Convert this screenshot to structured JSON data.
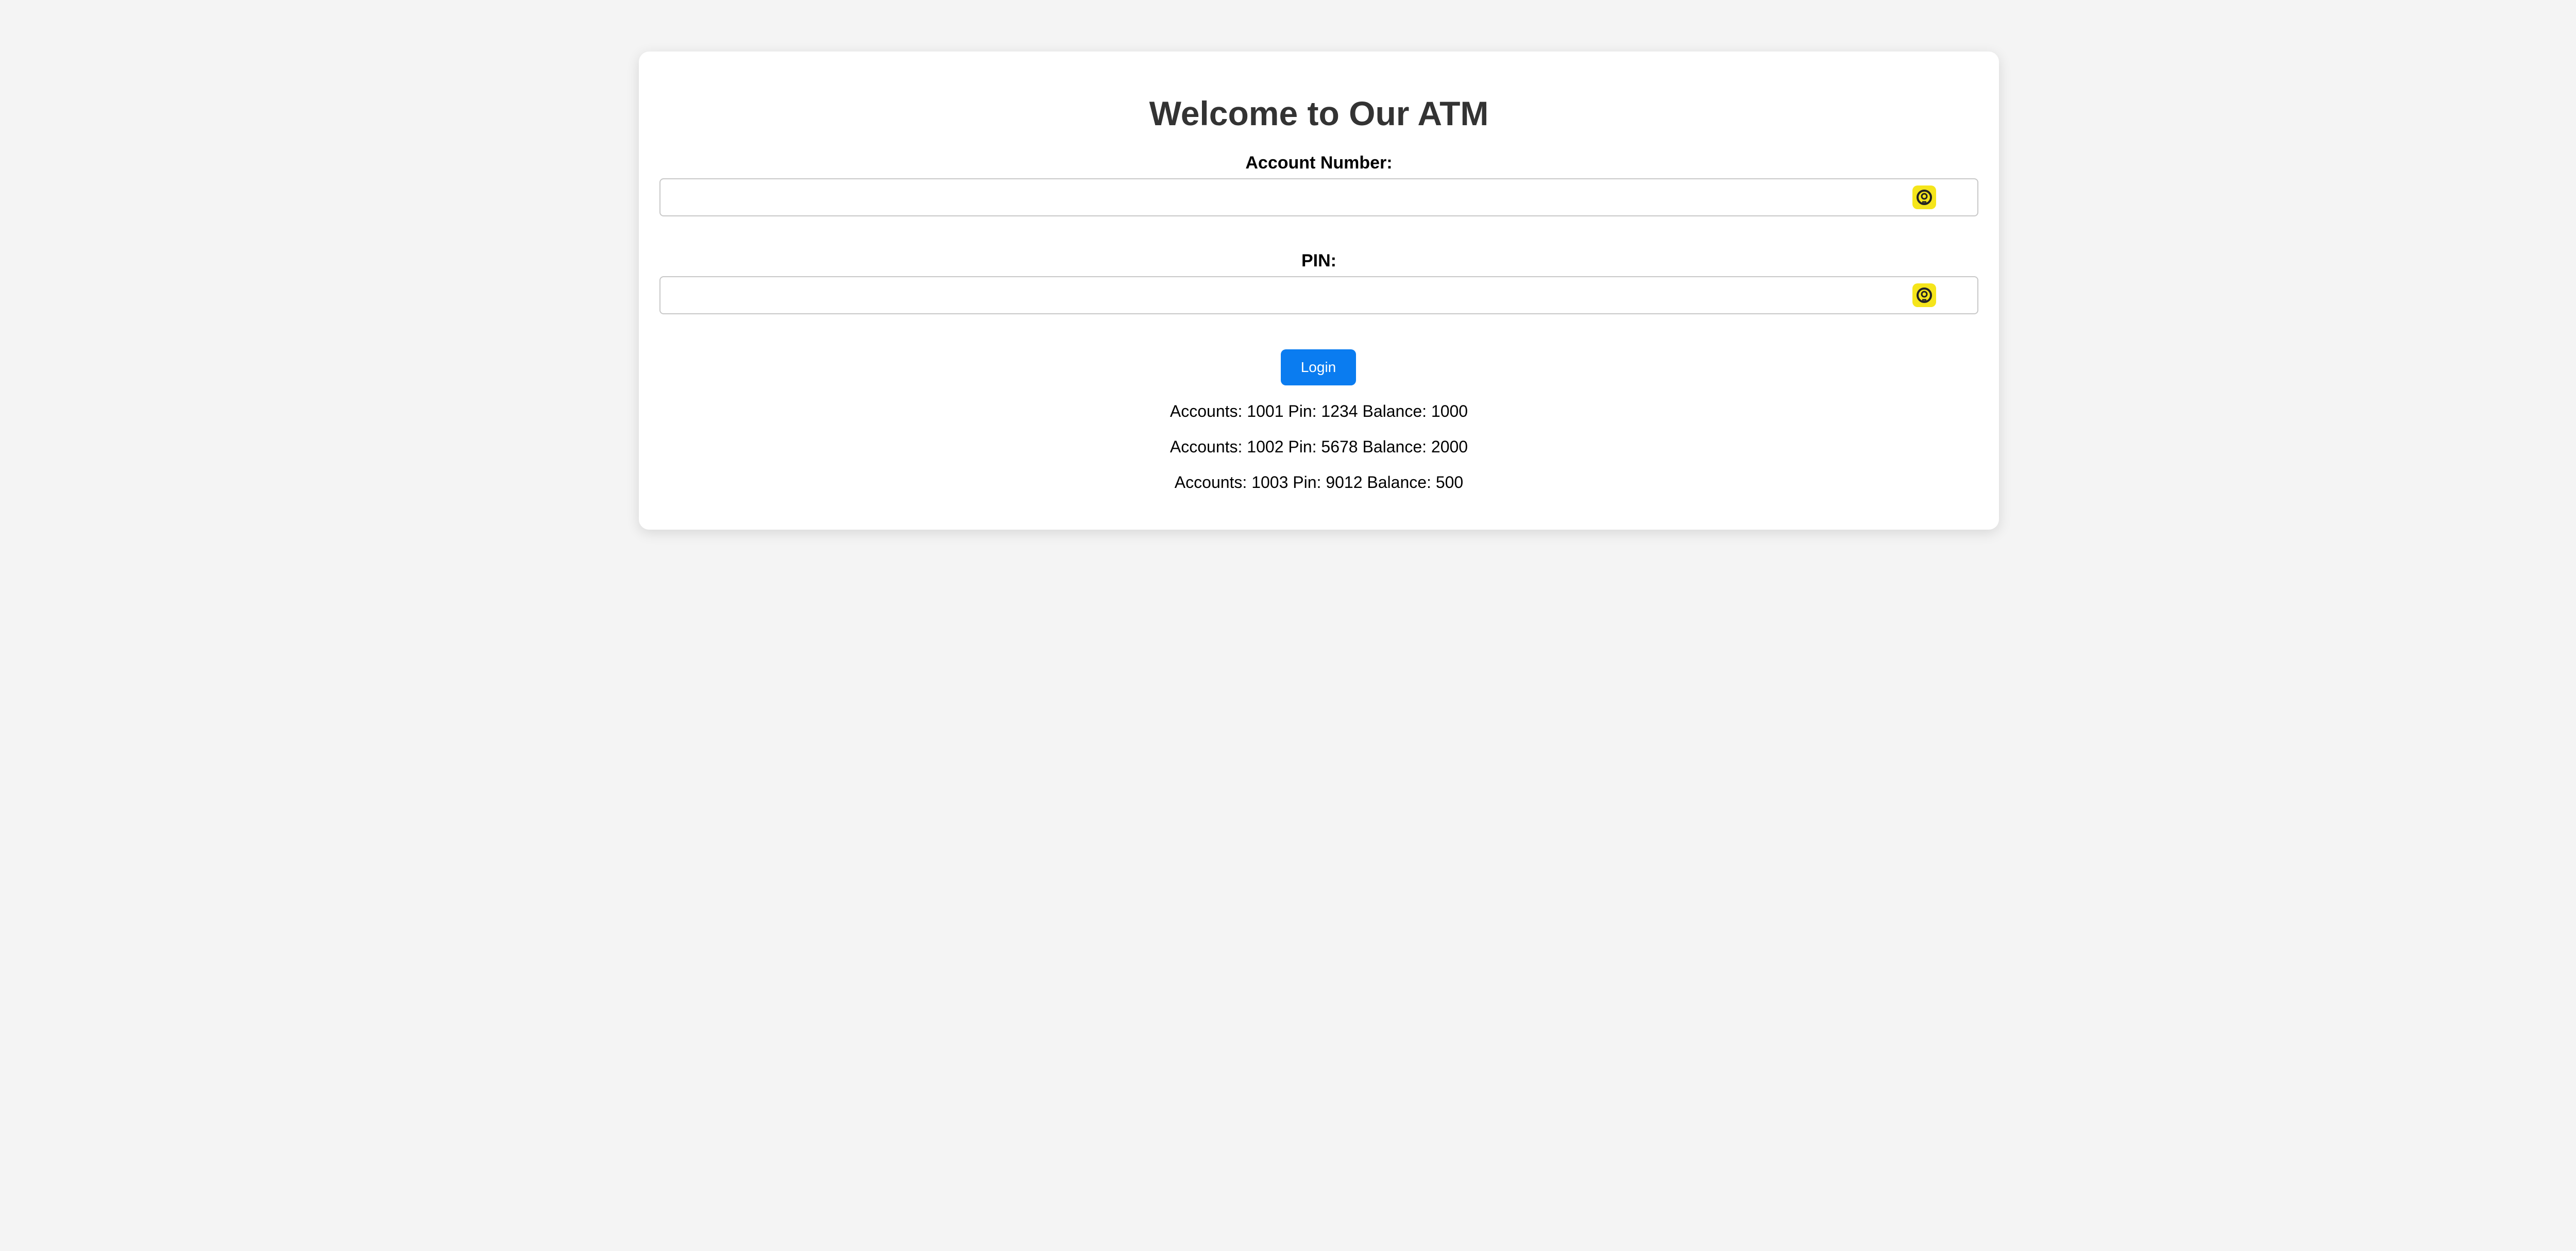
{
  "page": {
    "title": "Welcome to Our ATM"
  },
  "form": {
    "account_label": "Account Number:",
    "account_value": "",
    "pin_label": "PIN:",
    "pin_value": "",
    "login_label": "Login",
    "autofill_icon": "autofill-key-icon",
    "autofill_color": "#f5e51b"
  },
  "accounts": [
    "Accounts: 1001 Pin: 1234 Balance: 1000",
    "Accounts: 1002 Pin: 5678 Balance: 2000",
    "Accounts: 1003 Pin: 9012 Balance: 500"
  ],
  "colors": {
    "background": "#f4f4f4",
    "card": "#ffffff",
    "button": "#0a7cf0",
    "title": "#333333"
  }
}
